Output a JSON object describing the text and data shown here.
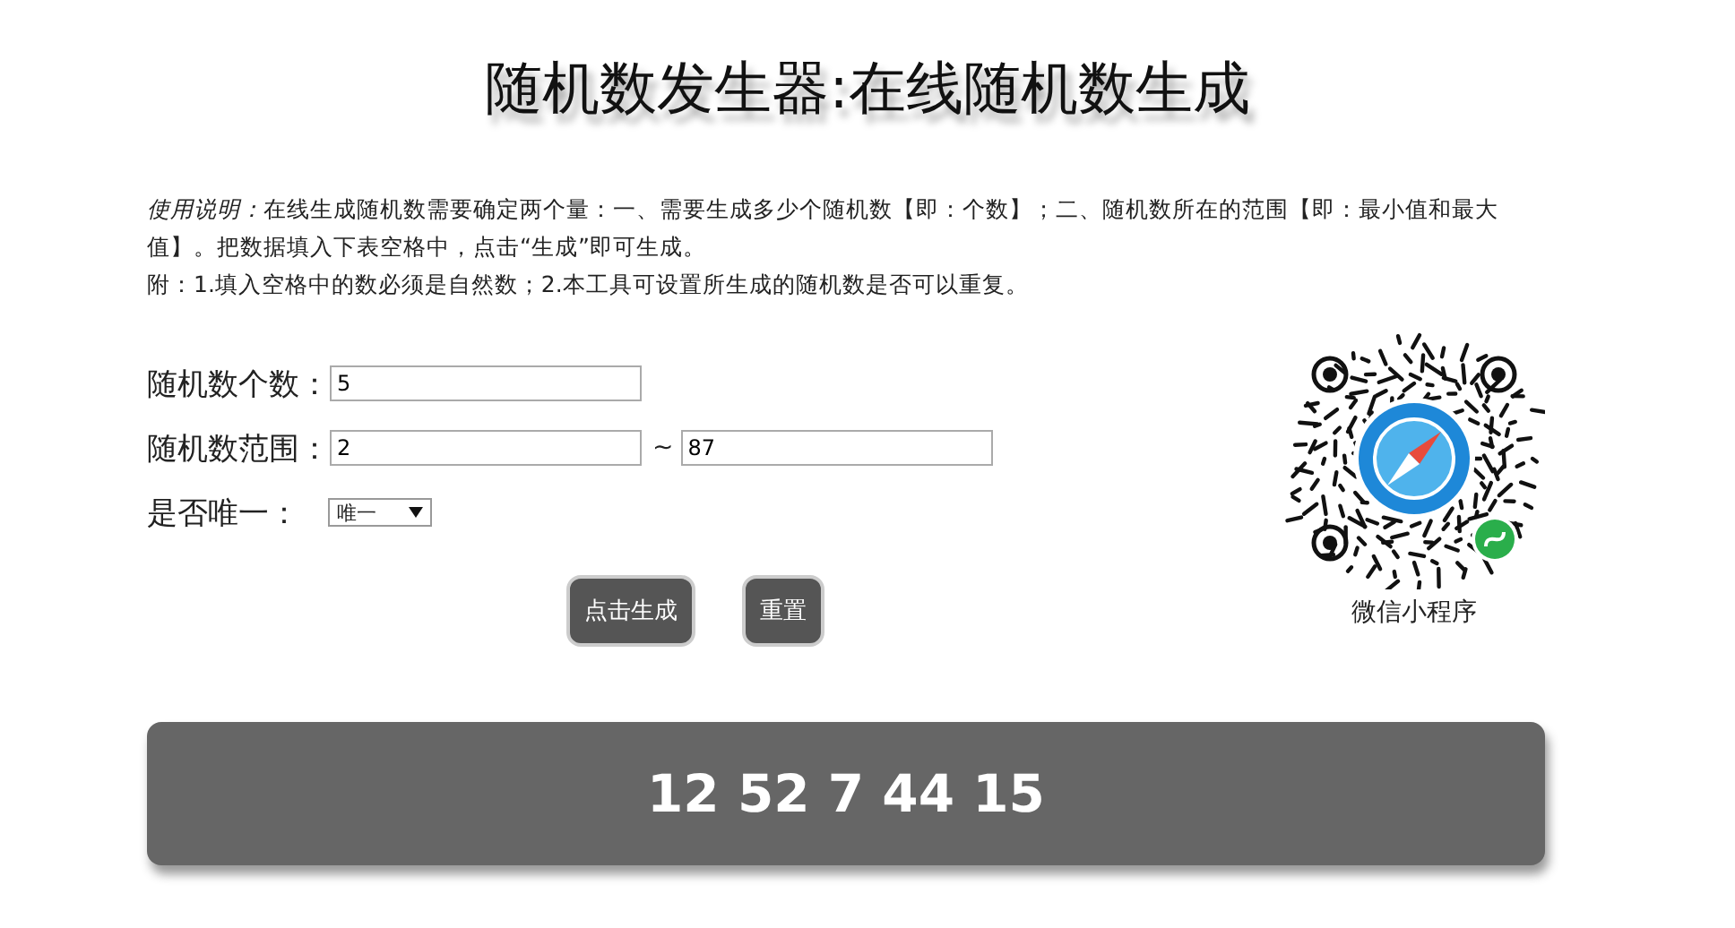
{
  "title": "随机数发生器:在线随机数生成",
  "instructions_lead": "使用说明：",
  "instructions": [
    "在线生成随机数需要确定两个量：一、需要生成多少个随机数【即：个数】；二、随机数所在的范围【即：最小值和最大值】。把数据填入下表空格中，点击“生成”即可生成。",
    "附：1.填入空格中的数必须是自然数；2.本工具可设置所生成的随机数是否可以重复。"
  ],
  "count": {
    "label": "随机数个数：",
    "value": "5"
  },
  "range": {
    "label": "随机数范围：",
    "min": "2",
    "separator": "~",
    "max": "87"
  },
  "unique": {
    "label": "是否唯一：",
    "value": "唯一"
  },
  "buttons": [
    "点击生成",
    "重置"
  ],
  "qr": {
    "caption": "微信小程序"
  },
  "result": "12 52 7 44 15"
}
